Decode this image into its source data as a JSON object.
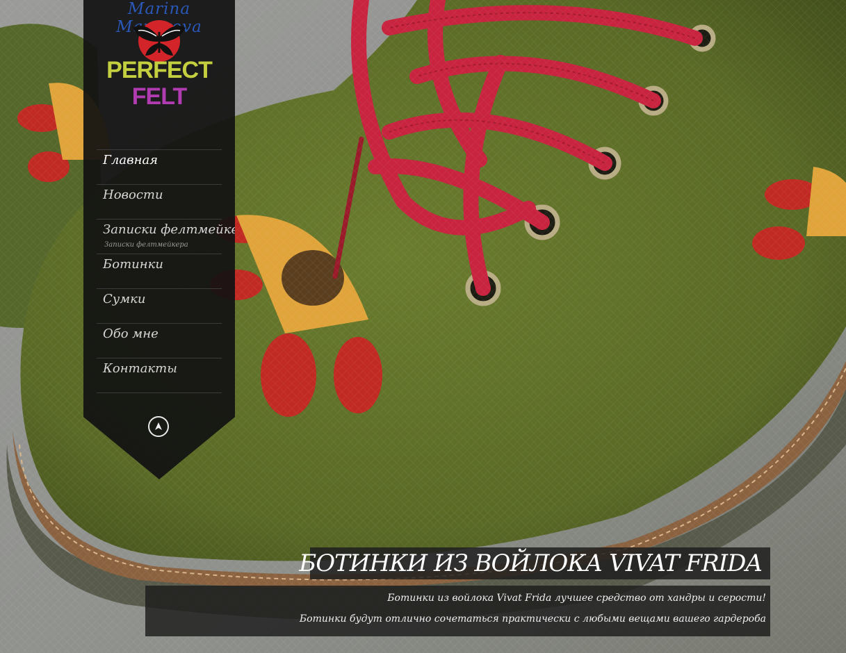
{
  "logo": {
    "script_text": "Marina Mayorova",
    "brand_word_1": "PERFECT",
    "brand_word_2": "FELT"
  },
  "nav": {
    "items": [
      {
        "label": "Главная",
        "active": true
      },
      {
        "label": "Новости"
      },
      {
        "label": "Записки фелтмейкера",
        "sub": "Записки фелтмейкера"
      },
      {
        "label": "Ботинки"
      },
      {
        "label": "Сумки"
      },
      {
        "label": "Обо мне"
      },
      {
        "label": "Контакты"
      }
    ]
  },
  "icons": {
    "up_button": "arrow-up-circle-icon",
    "logo_mark": "butterfly-icon"
  },
  "caption": {
    "title": "БОТИНКИ ИЗ ВОЙЛОКА VIVAT FRIDA",
    "line1": "Ботинки из войлока Vivat Frida лучшее средство от хандры и серости!",
    "line2": "Ботинки будут отлично сочетаться практически с любыми вещами вашего гардероба"
  },
  "colors": {
    "felt_green": "#5f7028",
    "lace_red": "#c8233f",
    "sidebar_bg": "#121212",
    "logo_blue": "#2a58b8",
    "logo_yellow": "#c4cf40",
    "logo_purple": "#b13bb0"
  }
}
